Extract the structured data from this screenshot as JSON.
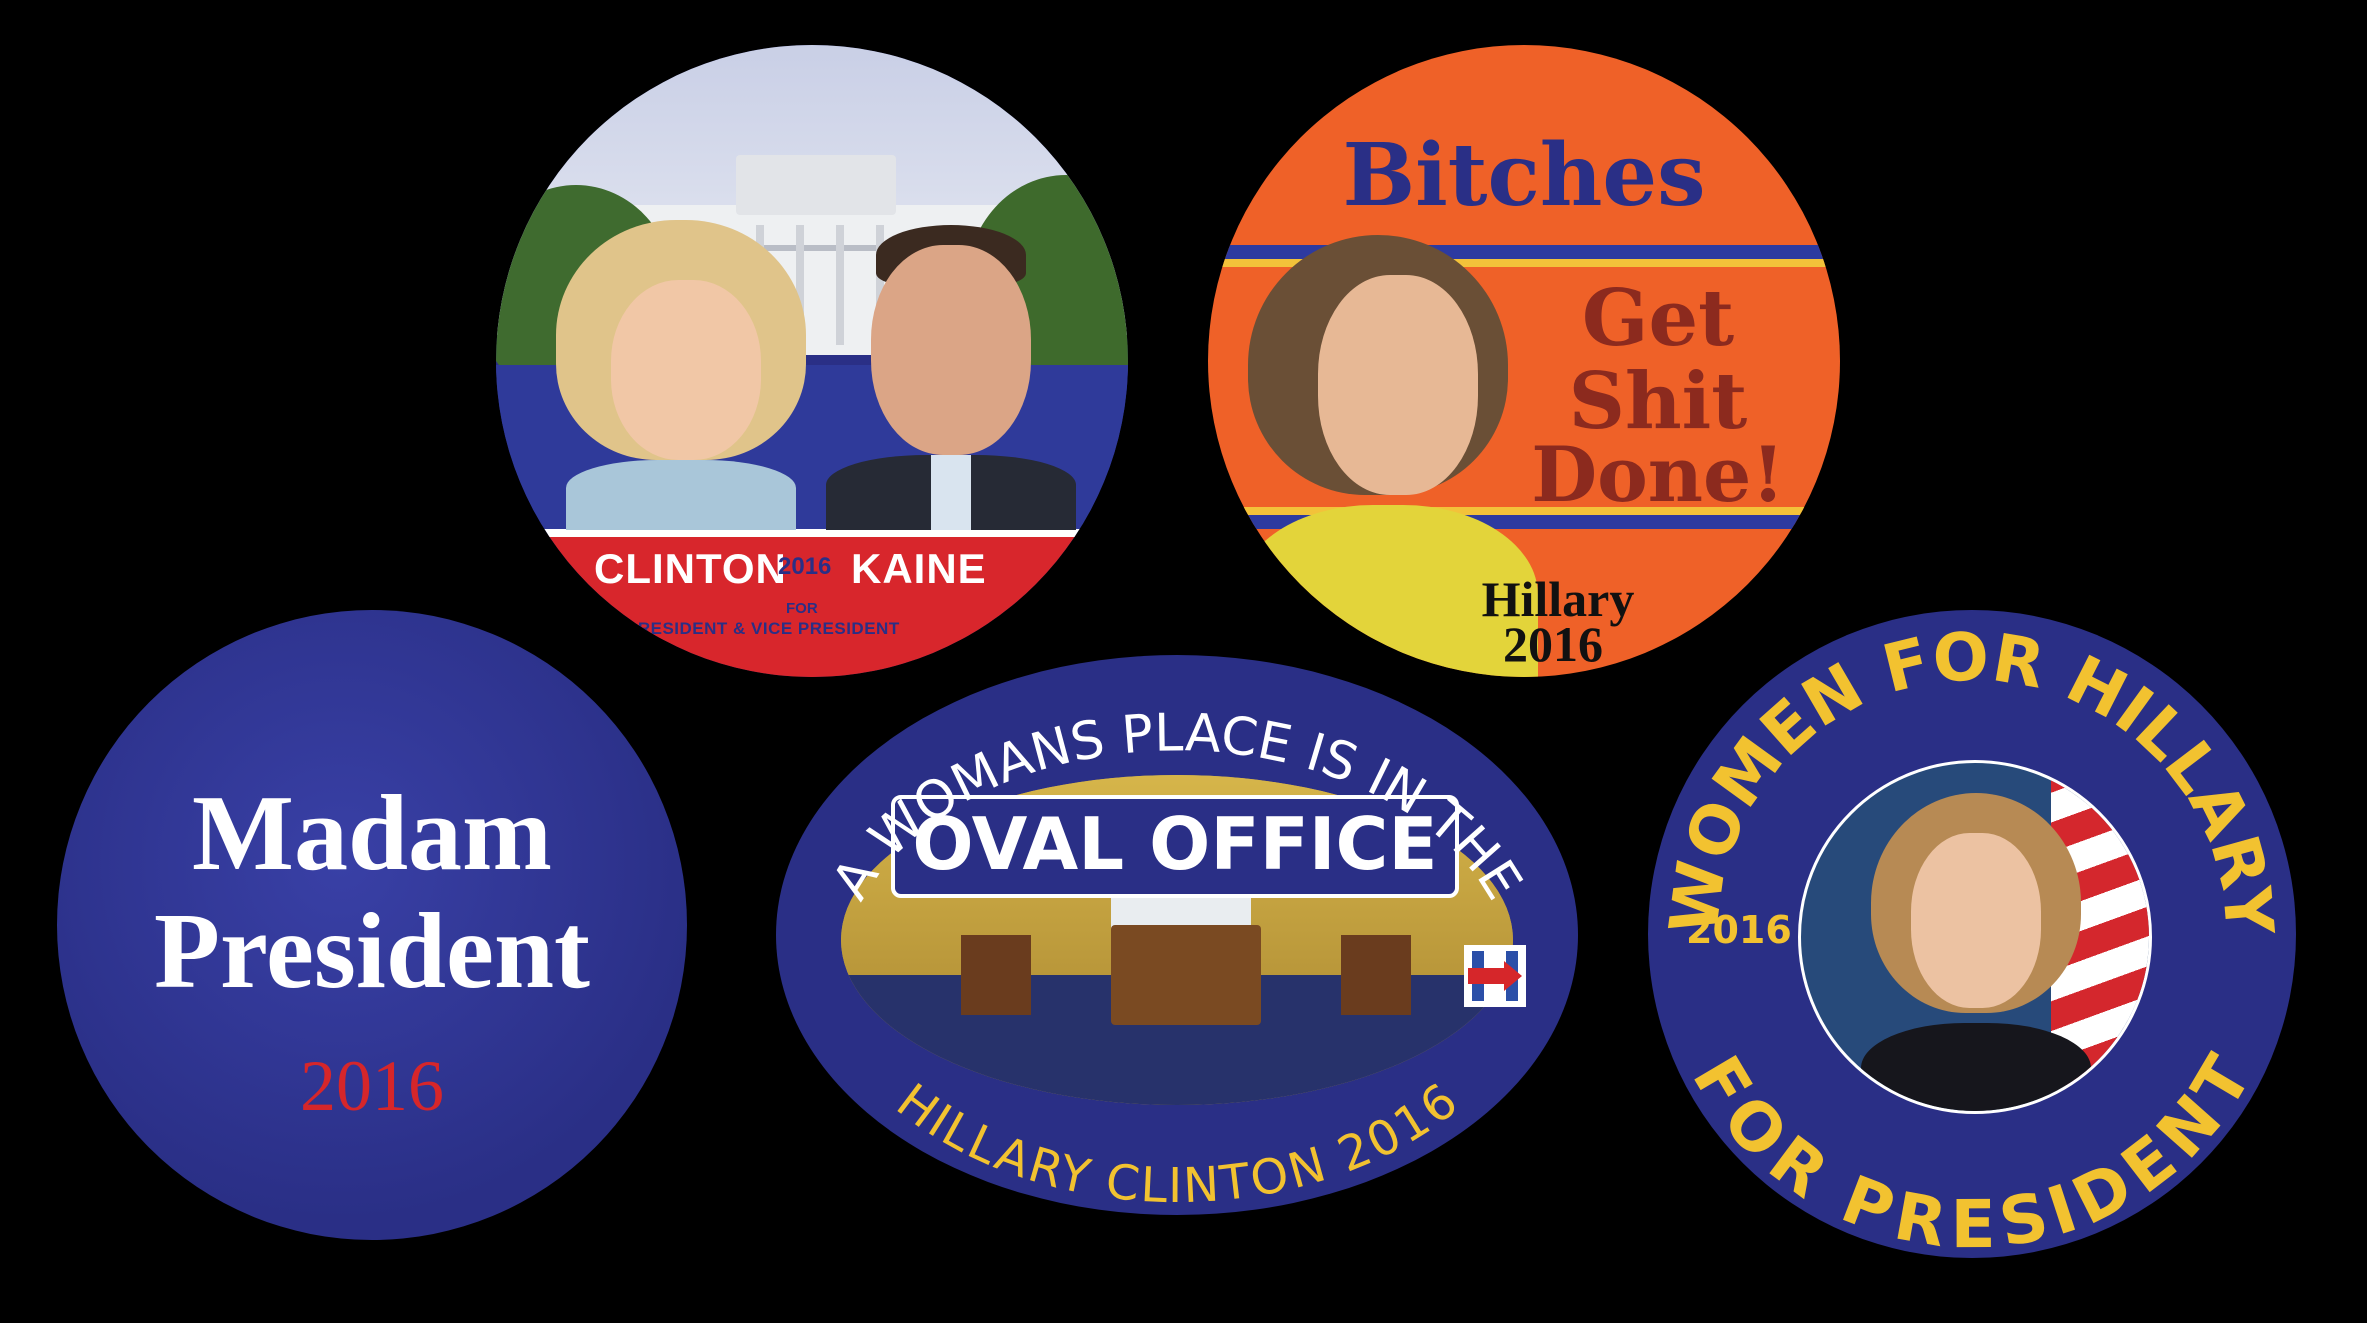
{
  "buttons": {
    "clinton_kaine": {
      "name_left": "CLINTON",
      "year": "2016",
      "name_right": "KAINE",
      "line_for": "FOR",
      "line_office": "PRESIDENT & VICE PRESIDENT"
    },
    "bitches": {
      "headline": "Bitches",
      "line1": "Get",
      "line2": "Shit",
      "line3": "Done!",
      "signature": "Hillary",
      "year": "2016"
    },
    "madam": {
      "line1": "Madam",
      "line2": "President",
      "year": "2016"
    },
    "oval": {
      "arc_top": "A WOMANS PLACE IS IN THE",
      "banner": "OVAL OFFICE",
      "arc_bottom": "HILLARY CLINTON 2016",
      "logo_letter": "H"
    },
    "women": {
      "arc_top": "WOMEN FOR HILLARY",
      "arc_bottom": "FOR PRESIDENT",
      "year": "2016"
    }
  },
  "colors": {
    "background": "#000000",
    "navy": "#2a2f86",
    "red": "#d6262a",
    "orange": "#f0662a",
    "gold": "#f2c230",
    "white": "#ffffff"
  }
}
